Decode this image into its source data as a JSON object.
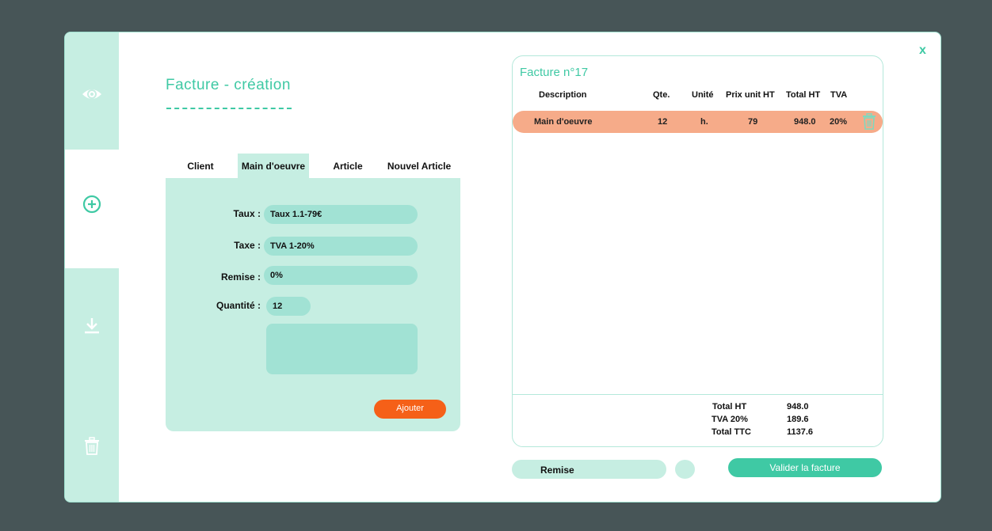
{
  "window": {
    "close_label": "x"
  },
  "sidebar": {
    "items": [
      {
        "icon": "eye-icon"
      },
      {
        "icon": "plus-circle-icon"
      },
      {
        "icon": "download-icon"
      },
      {
        "icon": "trash-icon"
      }
    ]
  },
  "page": {
    "title": "Facture - création"
  },
  "tabs": [
    {
      "label": "Client"
    },
    {
      "label": "Main d'oeuvre",
      "active": true
    },
    {
      "label": "Article"
    },
    {
      "label": "Nouvel Article"
    }
  ],
  "form": {
    "taux": {
      "label": "Taux :",
      "value": "Taux 1.1-79€"
    },
    "taxe": {
      "label": "Taxe :",
      "value": "TVA 1-20%"
    },
    "remise": {
      "label": "Remise :",
      "value": "0%"
    },
    "quantite": {
      "label": "Quantité :",
      "value": "12"
    },
    "notes": {
      "value": ""
    },
    "add_button": "Ajouter"
  },
  "invoice": {
    "title": "Facture n°17",
    "columns": [
      "Description",
      "Qte.",
      "Unité",
      "Prix unit HT",
      "Total HT",
      "TVA"
    ],
    "rows": [
      {
        "description": "Main d'oeuvre",
        "qte": "12",
        "unite": "h.",
        "prix": "79",
        "total": "948.0",
        "tva": "20%"
      }
    ],
    "totals": [
      {
        "label": "Total HT",
        "value": "948.0"
      },
      {
        "label": "TVA 20%",
        "value": "189.6"
      },
      {
        "label": "Total TTC",
        "value": "1137.6"
      }
    ]
  },
  "footer": {
    "remise_label": "Remise",
    "validate_button": "Valider la facture"
  },
  "colors": {
    "accent": "#3fc9a4",
    "panel": "#c6eee2",
    "field": "#a1e2d4",
    "row_highlight": "#f6ab89",
    "button_orange": "#f56018",
    "background": "#475557"
  }
}
